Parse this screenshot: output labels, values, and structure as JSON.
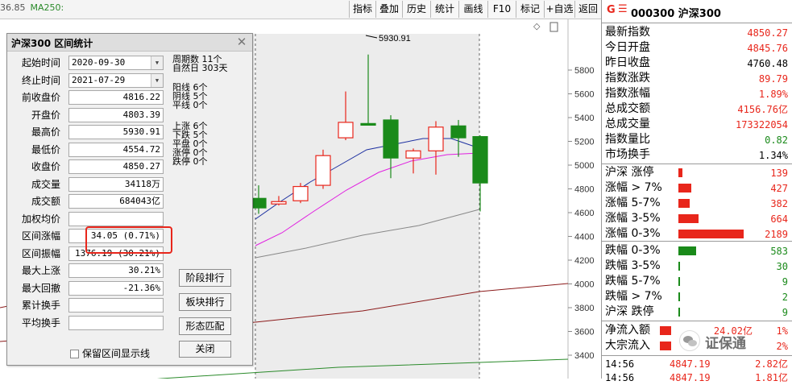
{
  "toolbar": {
    "ma_legend_cut": "36.85",
    "ma250_label": "MA250:",
    "buttons": [
      "指标",
      "叠加",
      "历史",
      "统计",
      "画线",
      "F10",
      "标记",
      "+自选",
      "返回"
    ]
  },
  "chart": {
    "y_ticks": [
      "5800",
      "5600",
      "5400",
      "5200",
      "5000",
      "4800",
      "4600",
      "4400",
      "4200",
      "4000",
      "3800",
      "3600",
      "3400"
    ],
    "high_marker": "5930.91",
    "colors": {
      "up": "#e8261b",
      "down": "#1a8a1a",
      "ma_fast": "#1c2fa0",
      "ma_mid": "#e020e0",
      "ma_slow": "#888888",
      "ma_long": "#8b1a1a",
      "ma250": "#2a8a2a"
    },
    "candles": [
      {
        "open": 4720,
        "high": 4830,
        "low": 4590,
        "close": 4640
      },
      {
        "open": 4673,
        "high": 4740,
        "low": 4660,
        "close": 4693
      },
      {
        "open": 4700,
        "high": 4850,
        "low": 4680,
        "close": 4820
      },
      {
        "open": 4830,
        "high": 5130,
        "low": 4800,
        "close": 5080
      },
      {
        "open": 5230,
        "high": 5620,
        "low": 5210,
        "close": 5360
      },
      {
        "open": 5350,
        "high": 5930.91,
        "low": 5340,
        "close": 5340
      },
      {
        "open": 5380,
        "high": 5420,
        "low": 4890,
        "close": 5060
      },
      {
        "open": 5060,
        "high": 5140,
        "low": 4930,
        "close": 5120
      },
      {
        "open": 5120,
        "high": 5370,
        "low": 4920,
        "close": 5320
      },
      {
        "open": 5330,
        "high": 5380,
        "low": 5070,
        "close": 5230
      },
      {
        "open": 5240,
        "high": 5250,
        "low": 4610,
        "close": 4850
      }
    ]
  },
  "dialog": {
    "title": "沪深300 区间统计",
    "close_icon": "close-icon",
    "fields": [
      {
        "label": "起始时间",
        "value": "2020-09-30",
        "combo": true
      },
      {
        "label": "终止时间",
        "value": "2021-07-29",
        "combo": true
      },
      {
        "label": "前收盘价",
        "value": "4816.22"
      },
      {
        "label": "开盘价",
        "value": "4803.39"
      },
      {
        "label": "最高价",
        "value": "5930.91"
      },
      {
        "label": "最低价",
        "value": "4554.72"
      },
      {
        "label": "收盘价",
        "value": "4850.27"
      },
      {
        "label": "成交量",
        "value": "34118万"
      },
      {
        "label": "成交额",
        "value": "684043亿"
      },
      {
        "label": "加权均价",
        "value": ""
      },
      {
        "label": "区间涨幅",
        "value": "34.05 (0.71%)"
      },
      {
        "label": "区间振幅",
        "value": "1376.19 (30.21%)"
      },
      {
        "label": "最大上涨",
        "value": "30.21%"
      },
      {
        "label": "最大回撤",
        "value": "-21.36%"
      },
      {
        "label": "累计换手",
        "value": ""
      },
      {
        "label": "平均换手",
        "value": ""
      }
    ],
    "period": {
      "weeks_label": "周期数",
      "weeks_value": "11个",
      "days_label": "自然日",
      "days_value": "303天"
    },
    "candle_stats": [
      {
        "label": "阳线",
        "value": "6个"
      },
      {
        "label": "阴线",
        "value": "5个"
      },
      {
        "label": "平线",
        "value": "0个"
      }
    ],
    "move_stats": [
      {
        "label": "上涨",
        "value": "6个"
      },
      {
        "label": "下跌",
        "value": "5个"
      },
      {
        "label": "平盘",
        "value": "0个"
      },
      {
        "label": "涨停",
        "value": "0个"
      },
      {
        "label": "跌停",
        "value": "0个"
      }
    ],
    "buttons": {
      "rank": "阶段排行",
      "sector_rank": "板块排行",
      "pattern": "形态匹配",
      "close": "关闭"
    },
    "checkbox_label": "保留区间显示线"
  },
  "panel": {
    "header_marker": "G",
    "header_menu_icon": "menu-icon",
    "header_title": "000300 沪深300",
    "quote": [
      {
        "label": "最新指数",
        "value": "4850.27",
        "color": "red"
      },
      {
        "label": "今日开盘",
        "value": "4845.76",
        "color": "red"
      },
      {
        "label": "昨日收盘",
        "value": "4760.48",
        "color": "black"
      },
      {
        "label": "指数涨跌",
        "value": "89.79",
        "color": "red"
      },
      {
        "label": "指数涨幅",
        "value": "1.89%",
        "color": "red"
      },
      {
        "label": "总成交额",
        "value": "4156.76亿",
        "color": "red"
      },
      {
        "label": "总成交量",
        "value": "173322054",
        "color": "red"
      },
      {
        "label": "指数量比",
        "value": "0.82",
        "color": "green"
      },
      {
        "label": "市场换手",
        "value": "1.34%",
        "color": "black"
      }
    ],
    "up_stats": [
      {
        "label": "沪深 涨停",
        "value": "139",
        "bar": 0.064
      },
      {
        "label": "涨幅 > 7%",
        "value": "427",
        "bar": 0.195
      },
      {
        "label": "涨幅 5-7%",
        "value": "382",
        "bar": 0.174
      },
      {
        "label": "涨幅 3-5%",
        "value": "664",
        "bar": 0.303
      },
      {
        "label": "涨幅 0-3%",
        "value": "2189",
        "bar": 1.0
      }
    ],
    "down_stats": [
      {
        "label": "跌幅 0-3%",
        "value": "583",
        "bar": 0.266
      },
      {
        "label": "跌幅 3-5%",
        "value": "30",
        "bar": 0.014
      },
      {
        "label": "跌幅 5-7%",
        "value": "9",
        "bar": 0.004
      },
      {
        "label": "跌幅 > 7%",
        "value": "2",
        "bar": 0.001
      },
      {
        "label": "沪深 跌停",
        "value": "9",
        "bar": 0.004
      }
    ],
    "flow": [
      {
        "label": "净流入额",
        "value": "24.02亿",
        "pct": "1%"
      },
      {
        "label": "大宗流入",
        "value": "",
        "pct": "2%"
      }
    ],
    "ticks": [
      {
        "time": "14:56",
        "price": "4847.19",
        "vol": "2.82亿"
      },
      {
        "time": "14:56",
        "price": "4847.19",
        "vol": "1.81亿"
      }
    ],
    "watermark": "证保通"
  }
}
